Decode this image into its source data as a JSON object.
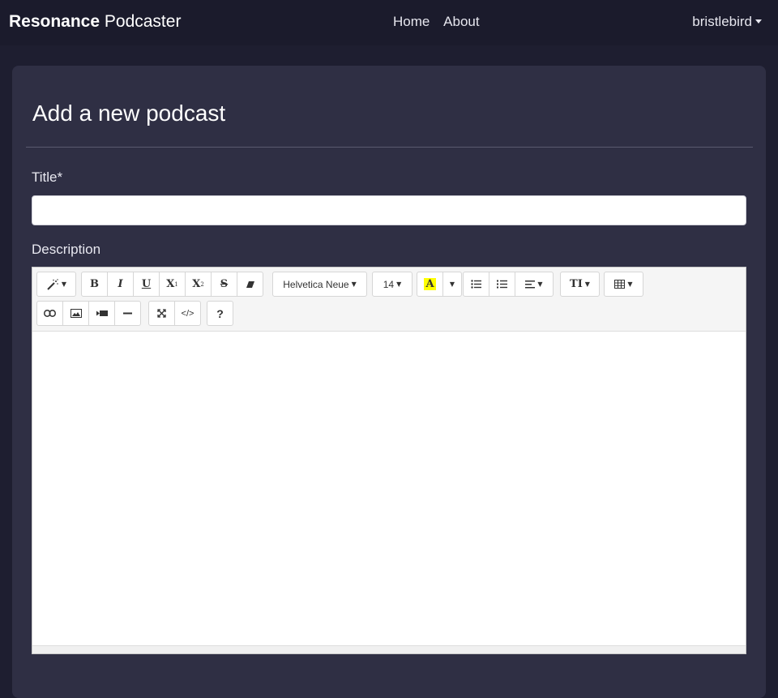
{
  "navbar": {
    "brand_bold": "Resonance",
    "brand_light": "Podcaster",
    "links": [
      "Home",
      "About"
    ],
    "user": "bristlebird"
  },
  "page": {
    "title": "Add a new podcast"
  },
  "form": {
    "title_label": "Title*",
    "title_value": "",
    "description_label": "Description"
  },
  "editor": {
    "font_family": "Helvetica Neue",
    "font_size": "14",
    "highlight_glyph": "A",
    "bold_glyph": "B",
    "italic_glyph": "I",
    "underline_glyph": "U",
    "superscript_glyph": "X",
    "subscript_glyph": "X",
    "strike_glyph": "S",
    "help_glyph": "?",
    "code_glyph": "</>",
    "style_glyph": "TI",
    "superscript_mark": "1",
    "subscript_mark": "2",
    "highlight_color": "#ffff00"
  }
}
